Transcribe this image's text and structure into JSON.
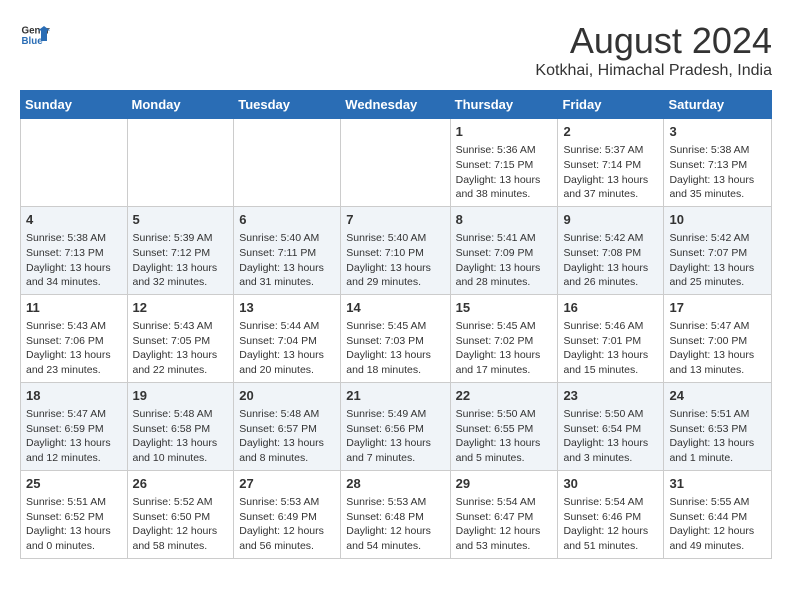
{
  "header": {
    "logo_line1": "General",
    "logo_line2": "Blue",
    "month_year": "August 2024",
    "location": "Kotkhai, Himachal Pradesh, India"
  },
  "days_of_week": [
    "Sunday",
    "Monday",
    "Tuesday",
    "Wednesday",
    "Thursday",
    "Friday",
    "Saturday"
  ],
  "weeks": [
    [
      {
        "day": "",
        "content": ""
      },
      {
        "day": "",
        "content": ""
      },
      {
        "day": "",
        "content": ""
      },
      {
        "day": "",
        "content": ""
      },
      {
        "day": "1",
        "content": "Sunrise: 5:36 AM\nSunset: 7:15 PM\nDaylight: 13 hours\nand 38 minutes."
      },
      {
        "day": "2",
        "content": "Sunrise: 5:37 AM\nSunset: 7:14 PM\nDaylight: 13 hours\nand 37 minutes."
      },
      {
        "day": "3",
        "content": "Sunrise: 5:38 AM\nSunset: 7:13 PM\nDaylight: 13 hours\nand 35 minutes."
      }
    ],
    [
      {
        "day": "4",
        "content": "Sunrise: 5:38 AM\nSunset: 7:13 PM\nDaylight: 13 hours\nand 34 minutes."
      },
      {
        "day": "5",
        "content": "Sunrise: 5:39 AM\nSunset: 7:12 PM\nDaylight: 13 hours\nand 32 minutes."
      },
      {
        "day": "6",
        "content": "Sunrise: 5:40 AM\nSunset: 7:11 PM\nDaylight: 13 hours\nand 31 minutes."
      },
      {
        "day": "7",
        "content": "Sunrise: 5:40 AM\nSunset: 7:10 PM\nDaylight: 13 hours\nand 29 minutes."
      },
      {
        "day": "8",
        "content": "Sunrise: 5:41 AM\nSunset: 7:09 PM\nDaylight: 13 hours\nand 28 minutes."
      },
      {
        "day": "9",
        "content": "Sunrise: 5:42 AM\nSunset: 7:08 PM\nDaylight: 13 hours\nand 26 minutes."
      },
      {
        "day": "10",
        "content": "Sunrise: 5:42 AM\nSunset: 7:07 PM\nDaylight: 13 hours\nand 25 minutes."
      }
    ],
    [
      {
        "day": "11",
        "content": "Sunrise: 5:43 AM\nSunset: 7:06 PM\nDaylight: 13 hours\nand 23 minutes."
      },
      {
        "day": "12",
        "content": "Sunrise: 5:43 AM\nSunset: 7:05 PM\nDaylight: 13 hours\nand 22 minutes."
      },
      {
        "day": "13",
        "content": "Sunrise: 5:44 AM\nSunset: 7:04 PM\nDaylight: 13 hours\nand 20 minutes."
      },
      {
        "day": "14",
        "content": "Sunrise: 5:45 AM\nSunset: 7:03 PM\nDaylight: 13 hours\nand 18 minutes."
      },
      {
        "day": "15",
        "content": "Sunrise: 5:45 AM\nSunset: 7:02 PM\nDaylight: 13 hours\nand 17 minutes."
      },
      {
        "day": "16",
        "content": "Sunrise: 5:46 AM\nSunset: 7:01 PM\nDaylight: 13 hours\nand 15 minutes."
      },
      {
        "day": "17",
        "content": "Sunrise: 5:47 AM\nSunset: 7:00 PM\nDaylight: 13 hours\nand 13 minutes."
      }
    ],
    [
      {
        "day": "18",
        "content": "Sunrise: 5:47 AM\nSunset: 6:59 PM\nDaylight: 13 hours\nand 12 minutes."
      },
      {
        "day": "19",
        "content": "Sunrise: 5:48 AM\nSunset: 6:58 PM\nDaylight: 13 hours\nand 10 minutes."
      },
      {
        "day": "20",
        "content": "Sunrise: 5:48 AM\nSunset: 6:57 PM\nDaylight: 13 hours\nand 8 minutes."
      },
      {
        "day": "21",
        "content": "Sunrise: 5:49 AM\nSunset: 6:56 PM\nDaylight: 13 hours\nand 7 minutes."
      },
      {
        "day": "22",
        "content": "Sunrise: 5:50 AM\nSunset: 6:55 PM\nDaylight: 13 hours\nand 5 minutes."
      },
      {
        "day": "23",
        "content": "Sunrise: 5:50 AM\nSunset: 6:54 PM\nDaylight: 13 hours\nand 3 minutes."
      },
      {
        "day": "24",
        "content": "Sunrise: 5:51 AM\nSunset: 6:53 PM\nDaylight: 13 hours\nand 1 minute."
      }
    ],
    [
      {
        "day": "25",
        "content": "Sunrise: 5:51 AM\nSunset: 6:52 PM\nDaylight: 13 hours\nand 0 minutes."
      },
      {
        "day": "26",
        "content": "Sunrise: 5:52 AM\nSunset: 6:50 PM\nDaylight: 12 hours\nand 58 minutes."
      },
      {
        "day": "27",
        "content": "Sunrise: 5:53 AM\nSunset: 6:49 PM\nDaylight: 12 hours\nand 56 minutes."
      },
      {
        "day": "28",
        "content": "Sunrise: 5:53 AM\nSunset: 6:48 PM\nDaylight: 12 hours\nand 54 minutes."
      },
      {
        "day": "29",
        "content": "Sunrise: 5:54 AM\nSunset: 6:47 PM\nDaylight: 12 hours\nand 53 minutes."
      },
      {
        "day": "30",
        "content": "Sunrise: 5:54 AM\nSunset: 6:46 PM\nDaylight: 12 hours\nand 51 minutes."
      },
      {
        "day": "31",
        "content": "Sunrise: 5:55 AM\nSunset: 6:44 PM\nDaylight: 12 hours\nand 49 minutes."
      }
    ]
  ]
}
